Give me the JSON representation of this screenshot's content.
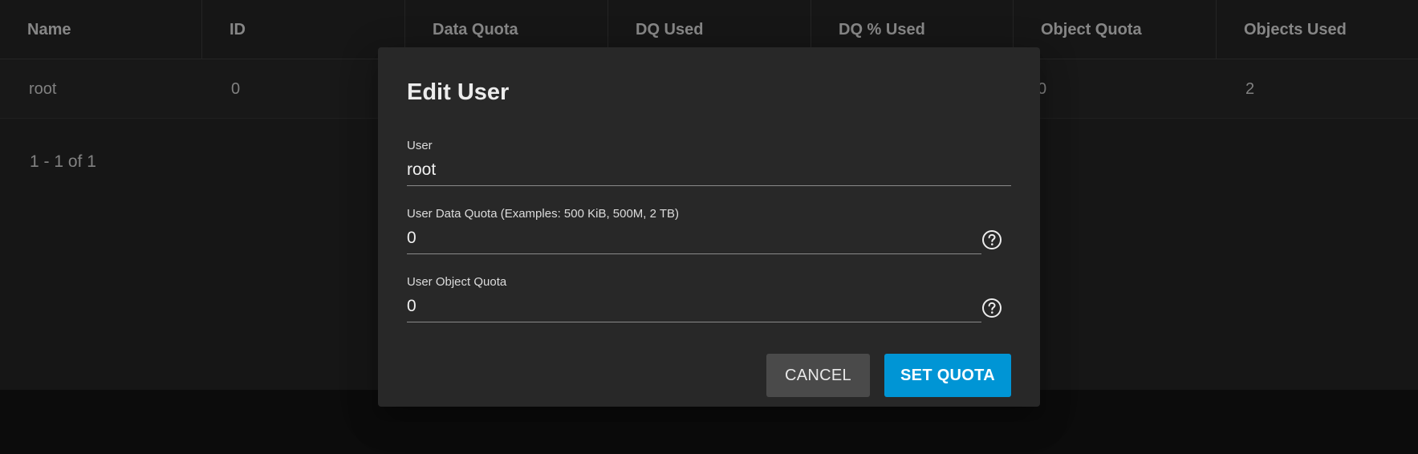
{
  "table": {
    "columns": [
      "Name",
      "ID",
      "Data Quota",
      "DQ Used",
      "DQ % Used",
      "Object Quota",
      "Objects Used"
    ],
    "rows": [
      {
        "name": "root",
        "id": "0",
        "data_quota": "",
        "dq_used": "",
        "dq_pct_used": "",
        "object_quota": "0",
        "objects_used": "2"
      }
    ],
    "paginator": "1 - 1 of 1"
  },
  "dialog": {
    "title": "Edit User",
    "user": {
      "label": "User",
      "value": "root"
    },
    "data_quota": {
      "label": "User Data Quota (Examples: 500 KiB, 500M, 2 TB)",
      "value": "0"
    },
    "object_quota": {
      "label": "User Object Quota",
      "value": "0"
    },
    "cancel_label": "CANCEL",
    "set_quota_label": "SET QUOTA"
  },
  "colors": {
    "background": "#141414",
    "dialog": "#282828",
    "primary_button": "#0095d5",
    "secondary_button": "#4a4a4a"
  },
  "icons": {
    "data_quota_help": "help-circle-icon",
    "object_quota_help": "help-circle-icon"
  }
}
